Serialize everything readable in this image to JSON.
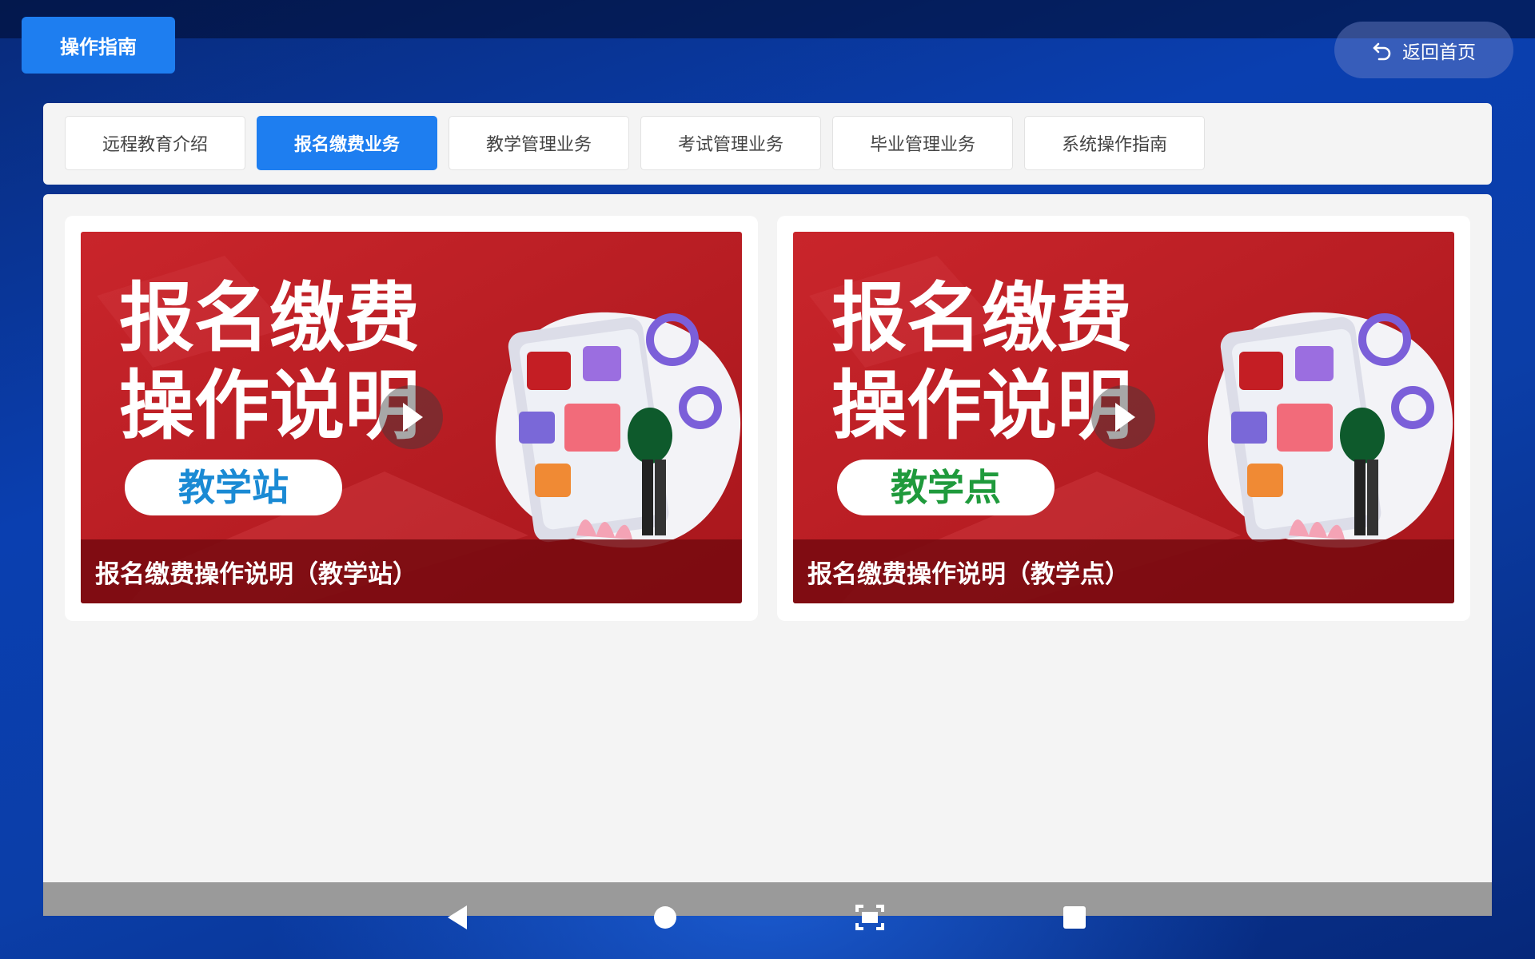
{
  "header": {
    "guide_label": "操作指南",
    "home_label": "返回首页"
  },
  "tabs": [
    {
      "label": "远程教育介绍",
      "active": false
    },
    {
      "label": "报名缴费业务",
      "active": true
    },
    {
      "label": "教学管理业务",
      "active": false
    },
    {
      "label": "考试管理业务",
      "active": false
    },
    {
      "label": "毕业管理业务",
      "active": false
    },
    {
      "label": "系统操作指南",
      "active": false
    }
  ],
  "cards": [
    {
      "banner_line1": "报名缴费",
      "banner_line2": "操作说明",
      "badge": "教学站",
      "badge_color": "#1a8ad4",
      "caption": "报名缴费操作说明（教学站）"
    },
    {
      "banner_line1": "报名缴费",
      "banner_line2": "操作说明",
      "badge": "教学点",
      "badge_color": "#1f9a3c",
      "caption": "报名缴费操作说明（教学点）"
    }
  ],
  "colors": {
    "accent": "#1e7ef0",
    "banner_red": "#c41e24",
    "caption_bg": "#7a0a10"
  },
  "icons": [
    "undo-arrow-icon",
    "back-triangle-icon",
    "home-circle-icon",
    "screenshot-icon",
    "recents-square-icon",
    "play-icon"
  ]
}
